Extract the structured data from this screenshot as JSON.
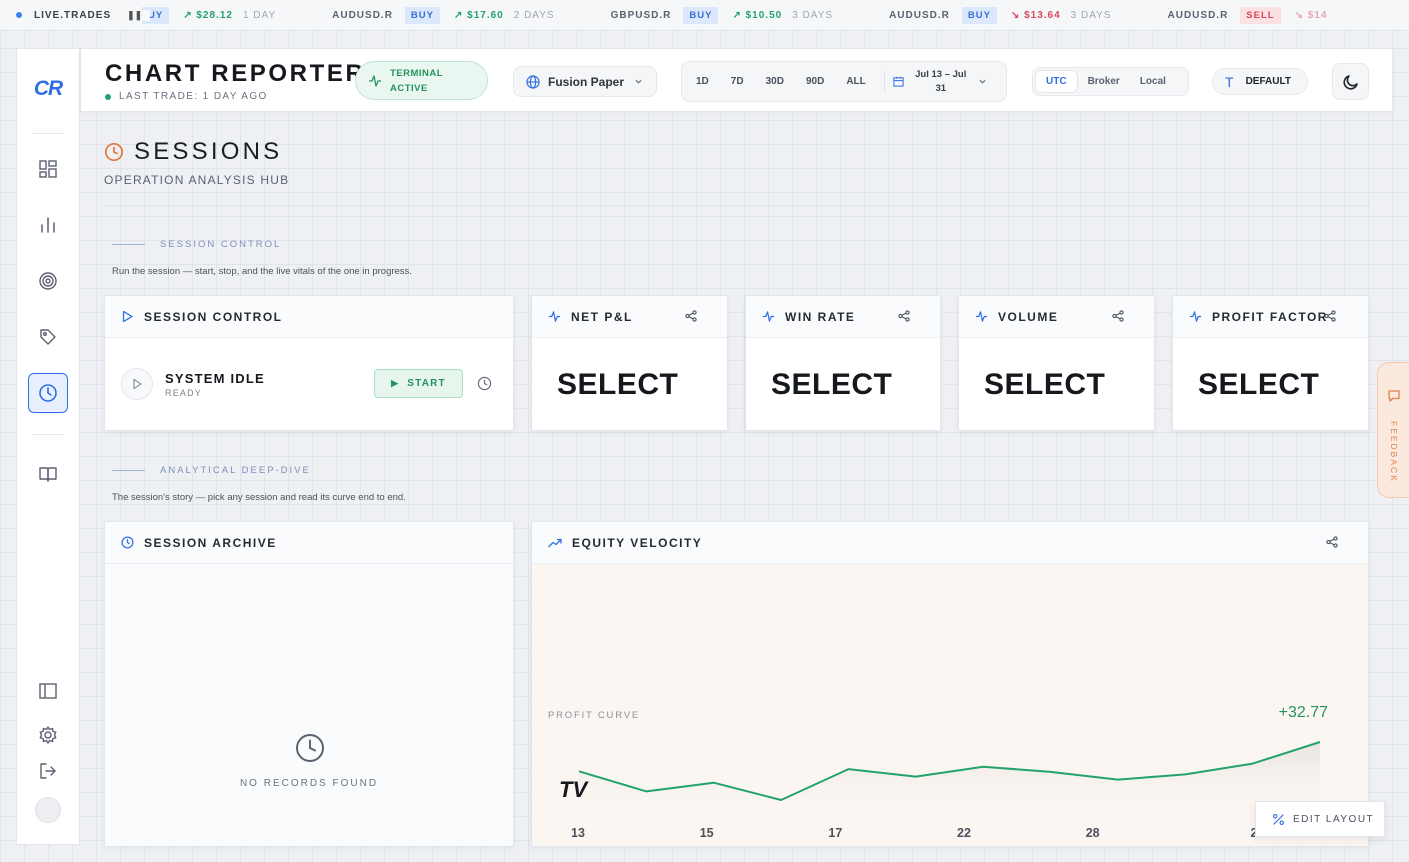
{
  "ticker": {
    "live_label": "LIVE.TRADES",
    "pause_glyph": "❚❚",
    "items": [
      {
        "symbol": "",
        "side": "BUY",
        "side_visible": "UY",
        "amount": "$28.12",
        "dir": "up",
        "age": "1 DAY"
      },
      {
        "symbol": "AUDUSD.R",
        "side": "BUY",
        "amount": "$17.60",
        "dir": "up",
        "age": "2 DAYS"
      },
      {
        "symbol": "GBPUSD.R",
        "side": "BUY",
        "amount": "$10.50",
        "dir": "up",
        "age": "3 DAYS"
      },
      {
        "symbol": "AUDUSD.R",
        "side": "BUY",
        "amount": "$13.64",
        "dir": "down",
        "age": "3 DAYS"
      },
      {
        "symbol": "AUDUSD.R",
        "side": "SELL",
        "amount": "$14",
        "dir": "down",
        "age": ""
      }
    ]
  },
  "sidebar": {
    "logo": "CR",
    "nav": [
      {
        "icon": "dashboard-icon"
      },
      {
        "icon": "bar-chart-icon"
      },
      {
        "icon": "target-icon"
      },
      {
        "icon": "tag-icon"
      },
      {
        "icon": "clock-icon",
        "active": true
      },
      {
        "icon": "book-icon"
      }
    ],
    "bottom": [
      {
        "icon": "sidebar-toggle-icon"
      },
      {
        "icon": "gear-icon"
      },
      {
        "icon": "logout-icon"
      }
    ]
  },
  "header": {
    "title": "CHART REPORTER",
    "last_trade": "LAST TRADE: 1 DAY AGO",
    "terminal": {
      "line1": "TERMINAL",
      "line2": "ACTIVE"
    },
    "account": "Fusion Paper",
    "ranges": [
      "1D",
      "7D",
      "30D",
      "90D",
      "ALL"
    ],
    "date_range": {
      "line1": "Jul 13 – Jul",
      "line2": "31"
    },
    "timezones": [
      {
        "label": "UTC",
        "active": true
      },
      {
        "label": "Broker",
        "active": false
      },
      {
        "label": "Local",
        "active": false
      }
    ],
    "font_label": "DEFAULT",
    "font_glyph": "T"
  },
  "page": {
    "title": "SESSIONS",
    "subtitle": "OPERATION ANALYSIS HUB",
    "section1": {
      "label": "SESSION CONTROL",
      "desc": "Run the session — start, stop, and the live vitals of the one in progress."
    },
    "section2": {
      "label": "ANALYTICAL DEEP-DIVE",
      "desc": "The session's story — pick any session and read its curve end to end."
    }
  },
  "session_control": {
    "title": "SESSION CONTROL",
    "status": "SYSTEM IDLE",
    "state": "READY",
    "start_label": "START"
  },
  "metrics": [
    {
      "title": "NET P&L",
      "value": "SELECT"
    },
    {
      "title": "WIN RATE",
      "value": "SELECT"
    },
    {
      "title": "VOLUME",
      "value": "SELECT"
    },
    {
      "title": "PROFIT FACTOR",
      "value": "SELECT"
    }
  ],
  "archive": {
    "title": "SESSION ARCHIVE",
    "empty": "NO RECORDS FOUND"
  },
  "equity": {
    "title": "EQUITY VELOCITY",
    "curve_label": "PROFIT CURVE",
    "curve_value": "+32.77",
    "watermark": "TV"
  },
  "chart_data": {
    "type": "line",
    "x_tick_labels": [
      "13",
      "15",
      "17",
      "22",
      "28",
      "2"
    ],
    "values": [
      4.5,
      -2.0,
      0.8,
      -4.8,
      5.2,
      2.8,
      6.0,
      4.3,
      1.8,
      3.5,
      7.0,
      14.0
    ],
    "line_color": "#23a36a"
  },
  "feedback_label": "FEEDBACK",
  "edit_layout_label": "EDIT LAYOUT"
}
